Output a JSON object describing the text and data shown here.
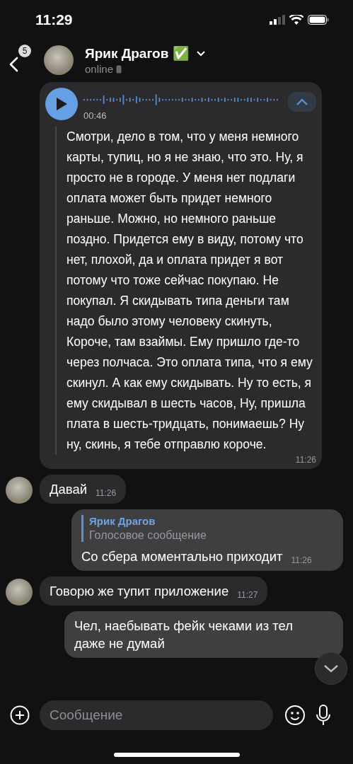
{
  "status_bar": {
    "time": "11:29"
  },
  "header": {
    "back_badge": "5",
    "name": "Ярик Драгов",
    "verified_emoji": "✅",
    "status": "online"
  },
  "messages": [
    {
      "kind": "voice",
      "outgoing": false,
      "avatar": false,
      "duration": "00:46",
      "transcript": "Смотри, дело в том, что у меня немного карты, тупиц, но я не знаю, что это. Ну, я просто не в городе. У меня нет подлаги оплата может быть придет немного раньше. Можно, но немного раньше поздно. Придется ему в виду, потому что нет, плохой, да и оплата придет я вот потому что тоже сейчас покупаю. Не покупал. Я скидывать типа деньги там надо было этому человеку скинуть, Короче, там взаймы. Ему пришло где-то через полчаса. Это оплата типа, что я ему скинул. А как ему скидывать. Ну то есть, я ему скидывал в шесть часов, Ну, пришла плата в шесть-тридцать, понимаешь? Ну ну, скинь, я тебе отправлю короче.",
      "time": "11:26"
    },
    {
      "kind": "text",
      "outgoing": false,
      "avatar": true,
      "text": "Давай",
      "time": "11:26"
    },
    {
      "kind": "reply",
      "outgoing": true,
      "avatar": false,
      "reply_to": {
        "author": "Ярик Драгов",
        "text": "Голосовое сообщение"
      },
      "text": "Со сбера моментально приходит",
      "time": "11:26"
    },
    {
      "kind": "text",
      "outgoing": false,
      "avatar": true,
      "text": "Говорю же тупит приложение",
      "time": "11:27"
    },
    {
      "kind": "text",
      "outgoing": true,
      "avatar": false,
      "text": "Чел, наебывать фейк чеками из тел\nдаже не думай"
    }
  ],
  "composer": {
    "placeholder": "Сообщение"
  }
}
